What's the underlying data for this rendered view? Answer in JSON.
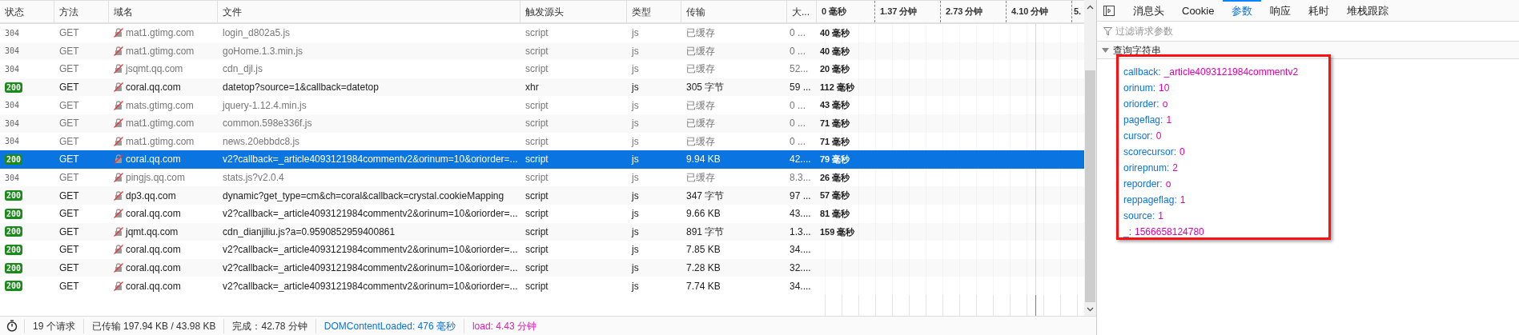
{
  "table": {
    "columns": [
      "状态",
      "方法",
      "域名",
      "文件",
      "触发源头",
      "类型",
      "传输",
      "大..."
    ],
    "waterfall_ticks": [
      "0 毫秒",
      "1.37 分钟",
      "2.73 分钟",
      "4.10 分钟",
      "5."
    ],
    "rows": [
      {
        "status": "304",
        "method": "GET",
        "domain": "mat1.gtimg.com",
        "file": "login_d802a5.js",
        "trigger": "script",
        "type": "js",
        "transfer": "已缓存",
        "size": "0 ...",
        "timing": "40 毫秒",
        "cached": true,
        "selected": false
      },
      {
        "status": "304",
        "method": "GET",
        "domain": "mat1.gtimg.com",
        "file": "goHome.1.3.min.js",
        "trigger": "script",
        "type": "js",
        "transfer": "已缓存",
        "size": "0 ...",
        "timing": "40 毫秒",
        "cached": true,
        "selected": false
      },
      {
        "status": "304",
        "method": "GET",
        "domain": "jsqmt.qq.com",
        "file": "cdn_djl.js",
        "trigger": "script",
        "type": "js",
        "transfer": "已缓存",
        "size": "52...",
        "timing": "20 毫秒",
        "cached": true,
        "selected": false
      },
      {
        "status": "200",
        "method": "GET",
        "domain": "coral.qq.com",
        "file": "datetop?source=1&callback=datetop",
        "trigger": "xhr",
        "type": "js",
        "transfer": "305 字节",
        "size": "59 ...",
        "timing": "112 毫秒",
        "cached": false,
        "selected": false
      },
      {
        "status": "304",
        "method": "GET",
        "domain": "mats.gtimg.com",
        "file": "jquery-1.12.4.min.js",
        "trigger": "script",
        "type": "js",
        "transfer": "已缓存",
        "size": "0 ...",
        "timing": "43 毫秒",
        "cached": true,
        "selected": false
      },
      {
        "status": "304",
        "method": "GET",
        "domain": "mat1.gtimg.com",
        "file": "common.598e336f.js",
        "trigger": "script",
        "type": "js",
        "transfer": "已缓存",
        "size": "0 ...",
        "timing": "71 毫秒",
        "cached": true,
        "selected": false
      },
      {
        "status": "304",
        "method": "GET",
        "domain": "mat1.gtimg.com",
        "file": "news.20ebbdc8.js",
        "trigger": "script",
        "type": "js",
        "transfer": "已缓存",
        "size": "0 ...",
        "timing": "71 毫秒",
        "cached": true,
        "selected": false
      },
      {
        "status": "200",
        "method": "GET",
        "domain": "coral.qq.com",
        "file": "v2?callback=_article4093121984commentv2&orinum=10&oriorder=...",
        "trigger": "script",
        "type": "js",
        "transfer": "9.94 KB",
        "size": "42....",
        "timing": "79 毫秒",
        "cached": false,
        "selected": true
      },
      {
        "status": "304",
        "method": "GET",
        "domain": "pingjs.qq.com",
        "file": "stats.js?v2.0.4",
        "trigger": "script",
        "type": "js",
        "transfer": "已缓存",
        "size": "8.3...",
        "timing": "26 毫秒",
        "cached": true,
        "selected": false
      },
      {
        "status": "200",
        "method": "GET",
        "domain": "dp3.qq.com",
        "file": "dynamic?get_type=cm&ch=coral&callback=crystal.cookieMapping",
        "trigger": "script",
        "type": "js",
        "transfer": "347 字节",
        "size": "97 ...",
        "timing": "57 毫秒",
        "cached": false,
        "selected": false
      },
      {
        "status": "200",
        "method": "GET",
        "domain": "coral.qq.com",
        "file": "v2?callback=_article4093121984commentv2&orinum=10&oriorder=...",
        "trigger": "script",
        "type": "js",
        "transfer": "9.66 KB",
        "size": "43....",
        "timing": "81 毫秒",
        "cached": false,
        "selected": false
      },
      {
        "status": "200",
        "method": "GET",
        "domain": "jqmt.qq.com",
        "file": "cdn_dianjiliu.js?a=0.9590852959400861",
        "trigger": "script",
        "type": "js",
        "transfer": "891 字节",
        "size": "1.3...",
        "timing": "159 毫秒",
        "cached": false,
        "selected": false
      },
      {
        "status": "200",
        "method": "GET",
        "domain": "coral.qq.com",
        "file": "v2?callback=_article4093121984commentv2&orinum=10&oriorder=...",
        "trigger": "script",
        "type": "js",
        "transfer": "7.85 KB",
        "size": "34....",
        "cached": false,
        "selected": false
      },
      {
        "status": "200",
        "method": "GET",
        "domain": "coral.qq.com",
        "file": "v2?callback=_article4093121984commentv2&orinum=10&oriorder=...",
        "trigger": "script",
        "type": "js",
        "transfer": "7.28 KB",
        "size": "32....",
        "cached": false,
        "selected": false
      },
      {
        "status": "200",
        "method": "GET",
        "domain": "coral.qq.com",
        "file": "v2?callback=_article4093121984commentv2&orinum=10&oriorder=...",
        "trigger": "script",
        "type": "js",
        "transfer": "7.74 KB",
        "size": "34....",
        "cached": false,
        "selected": false
      }
    ]
  },
  "status_bar": {
    "requests": "19 个请求",
    "transferred": "已传输 197.94 KB / 43.98 KB",
    "finish": "完成：42.78 分钟",
    "dom_content_loaded": "DOMContentLoaded: 476 毫秒",
    "load": "load: 4.43 分钟"
  },
  "details": {
    "tabs": [
      {
        "label": "消息头",
        "selected": false
      },
      {
        "label": "Cookie",
        "selected": false
      },
      {
        "label": "参数",
        "selected": true
      },
      {
        "label": "响应",
        "selected": false
      },
      {
        "label": "耗时",
        "selected": false
      },
      {
        "label": "堆栈跟踪",
        "selected": false
      }
    ],
    "filter": {
      "placeholder": "过滤请求参数"
    },
    "section": {
      "title": "查询字符串",
      "expanded": true
    },
    "params": [
      {
        "key": "callback:",
        "value": "_article4093121984commentv2"
      },
      {
        "key": "orinum:",
        "value": "10"
      },
      {
        "key": "oriorder:",
        "value": "o"
      },
      {
        "key": "pageflag:",
        "value": "1"
      },
      {
        "key": "cursor:",
        "value": "0"
      },
      {
        "key": "scorecursor:",
        "value": "0"
      },
      {
        "key": "orirepnum:",
        "value": "2"
      },
      {
        "key": "reporder:",
        "value": "o"
      },
      {
        "key": "reppageflag:",
        "value": "1"
      },
      {
        "key": "source:",
        "value": "1"
      },
      {
        "key": "_:",
        "value": "1566658124780"
      }
    ]
  }
}
